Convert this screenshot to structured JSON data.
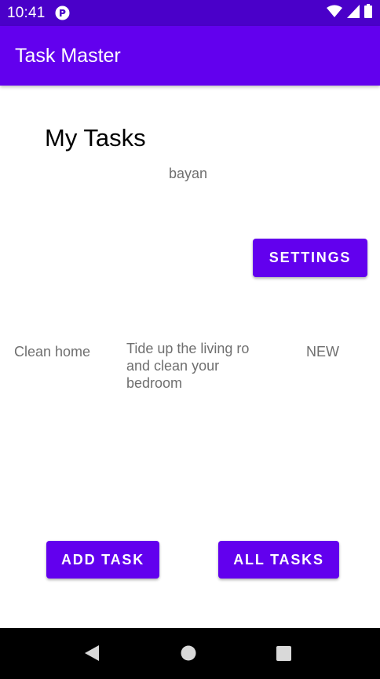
{
  "status_bar": {
    "time": "10:41",
    "icons": [
      "app-notification-icon",
      "wifi-icon",
      "signal-icon",
      "battery-icon"
    ],
    "color": "#4a00c9"
  },
  "app_bar": {
    "title": "Task Master",
    "color": "#6200ee"
  },
  "main": {
    "heading": "My Tasks",
    "username": "bayan",
    "settings_label": "SETTINGS",
    "task": {
      "title": "Clean home",
      "body": "Tide up the living ro and clean your bedroom",
      "state": "NEW"
    },
    "add_task_label": "ADD TASK",
    "all_tasks_label": "ALL TASKS"
  },
  "nav_bar": {
    "icons": [
      "back-icon",
      "home-icon",
      "recents-icon"
    ]
  }
}
